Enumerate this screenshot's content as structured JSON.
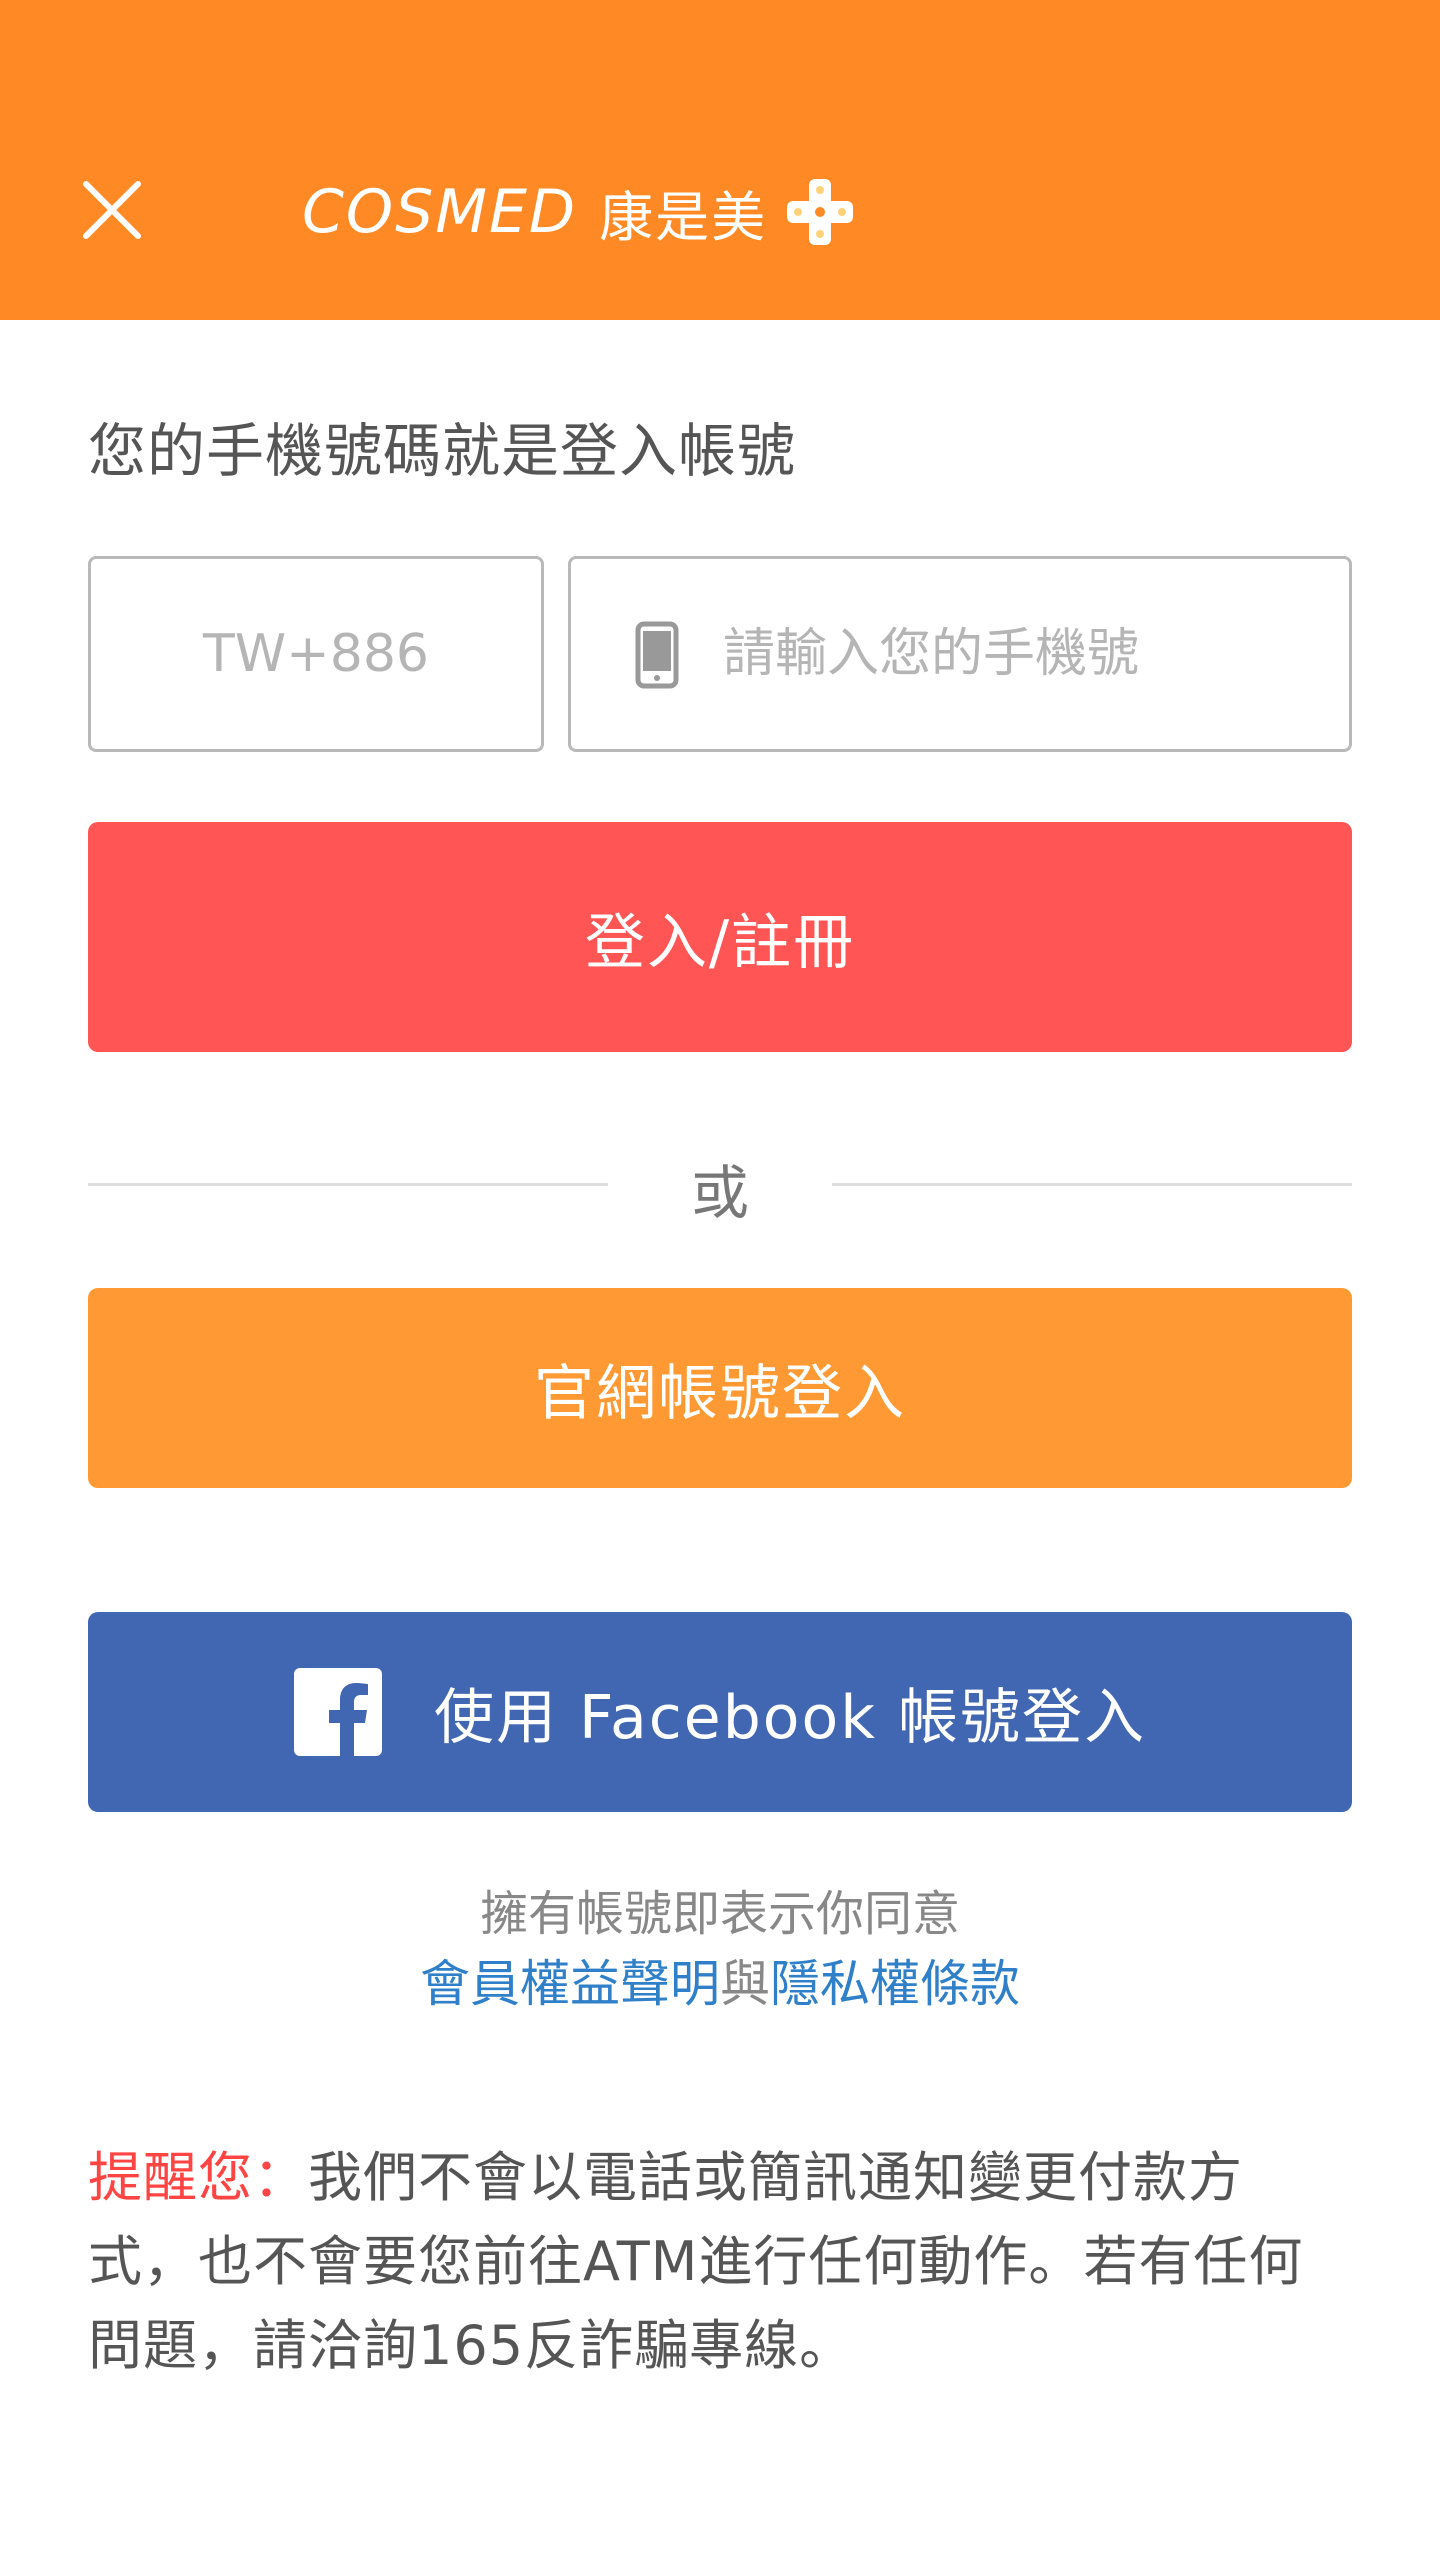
{
  "header": {
    "logo_text": "COSMED",
    "logo_chinese": "康是美",
    "colors": {
      "background": "#ff8a25"
    },
    "close_icon": "close-icon",
    "logo_icon": "cosmed-cross-icon"
  },
  "login": {
    "prompt": "您的手機號碼就是登入帳號",
    "country_code_placeholder": "TW+886",
    "phone_placeholder": "請輸入您的手機號",
    "phone_icon": "mobile-phone-icon",
    "login_button_label": "登入/註冊",
    "divider_text": "或",
    "official_login_label": "官網帳號登入",
    "facebook_login_label": "使用 Facebook 帳號登入",
    "facebook_icon": "facebook-icon",
    "colors": {
      "login_button": "#ff5555",
      "official_button": "#ff9933",
      "facebook_button": "#4267b2",
      "link": "#2f7fc9",
      "notice_label": "#ff4444"
    }
  },
  "agreement": {
    "line1": "擁有帳號即表示你同意",
    "terms_link": "會員權益聲明",
    "connector": "與",
    "privacy_link": "隱私權條款"
  },
  "notice": {
    "label": "提醒您：",
    "text": "我們不會以電話或簡訊通知變更付款方式，也不會要您前往ATM進行任何動作。若有任何問題，請洽詢165反詐騙專線。"
  }
}
